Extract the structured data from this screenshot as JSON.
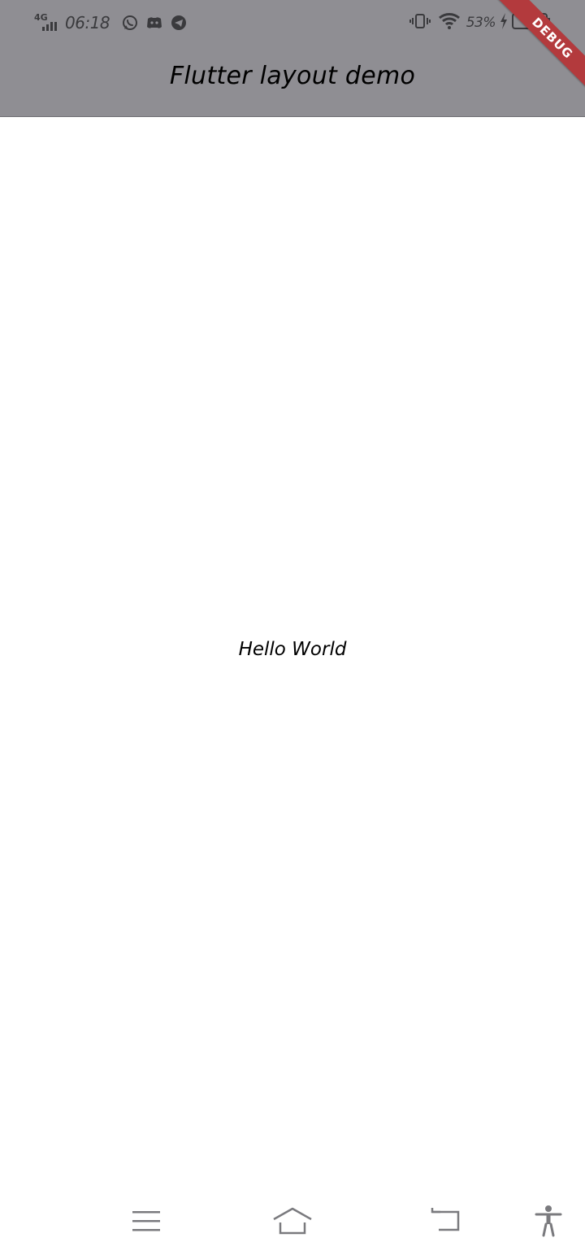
{
  "status_bar": {
    "network": "4G",
    "time": "06:18",
    "battery_percent": "53%",
    "notification_icons": [
      "whatsapp-icon",
      "discord-icon",
      "telegram-icon"
    ],
    "right_icons": [
      "vibrate-icon",
      "wifi-icon",
      "charging-icon",
      "battery-icon"
    ]
  },
  "app_bar": {
    "title": "Flutter layout demo",
    "background_color": "#8f8e93"
  },
  "debug_banner": {
    "label": "DEBUG",
    "color": "#b33a3d"
  },
  "body": {
    "text": "Hello World"
  },
  "nav_bar": {
    "buttons": [
      "menu-icon",
      "home-icon",
      "back-icon",
      "accessibility-icon"
    ]
  }
}
